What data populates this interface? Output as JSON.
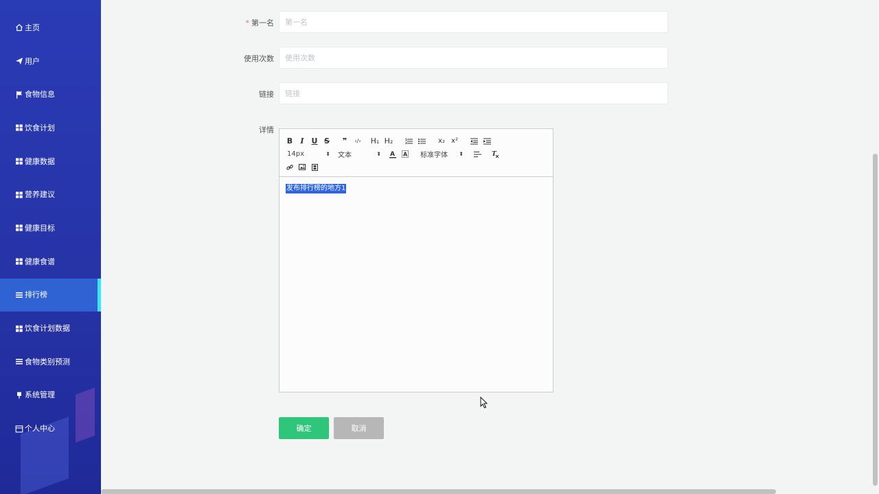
{
  "sidebar": {
    "items": [
      {
        "label": "主页",
        "icon": "home-icon",
        "active": false
      },
      {
        "label": "用户",
        "icon": "send-icon",
        "active": false
      },
      {
        "label": "食物信息",
        "icon": "flag-icon",
        "active": false
      },
      {
        "label": "饮食计划",
        "icon": "grid-icon",
        "active": false
      },
      {
        "label": "健康数据",
        "icon": "grid-icon",
        "active": false
      },
      {
        "label": "营养建议",
        "icon": "grid-icon",
        "active": false
      },
      {
        "label": "健康目标",
        "icon": "grid-icon",
        "active": false
      },
      {
        "label": "健康食谱",
        "icon": "grid-icon",
        "active": false
      },
      {
        "label": "排行榜",
        "icon": "list-icon",
        "active": true
      },
      {
        "label": "饮食计划数据",
        "icon": "grid-icon",
        "active": false
      },
      {
        "label": "食物类别预测",
        "icon": "list-icon",
        "active": false
      },
      {
        "label": "系统管理",
        "icon": "pin-icon",
        "active": false
      },
      {
        "label": "个人中心",
        "icon": "calendar-icon",
        "active": false
      }
    ],
    "colors": {
      "background": "#2633a6",
      "active": "#2f63d3",
      "accent": "#3fe3ff"
    }
  },
  "form": {
    "first_name": {
      "label": "第一名",
      "required_mark": "*",
      "value": "",
      "placeholder": "第一名"
    },
    "usage_count": {
      "label": "使用次数",
      "value": "",
      "placeholder": "使用次数"
    },
    "link": {
      "label": "链接",
      "value": "",
      "placeholder": "链接"
    },
    "details": {
      "label": "详情"
    }
  },
  "editor": {
    "toolbar": {
      "bold": "B",
      "italic": "I",
      "underline": "U",
      "strike": "S",
      "blockquote": "❞",
      "code": "‹/›",
      "h1": "H₁",
      "h2": "H₂",
      "subscript": "x₂",
      "superscript": "x²",
      "font_size": "14px",
      "header_select": "文本",
      "font_family": "标准字体"
    },
    "content": "发布排行榜的地方1"
  },
  "buttons": {
    "confirm": "确定",
    "cancel": "取消"
  },
  "colors": {
    "confirm": "#2fc57a",
    "cancel": "#b7b7b7",
    "selection": "#2f66e0"
  }
}
